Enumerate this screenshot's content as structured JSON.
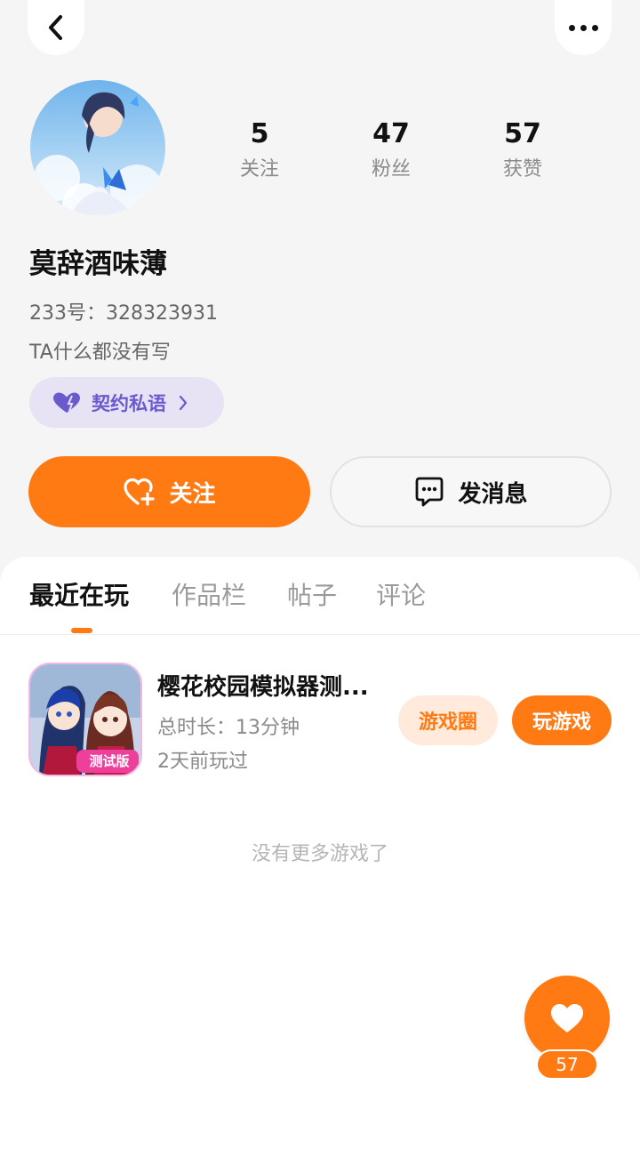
{
  "header": {
    "back_icon": "chevron-left-icon",
    "more_icon": "more-dots-icon"
  },
  "profile": {
    "nickname": "莫辞酒味薄",
    "uid_label": "233号：",
    "uid_value": "328323931",
    "bio": "TA什么都没有写",
    "stats": [
      {
        "value": "5",
        "label": "关注"
      },
      {
        "value": "47",
        "label": "粉丝"
      },
      {
        "value": "57",
        "label": "获赞"
      }
    ],
    "contract_label": "契约私语"
  },
  "actions": {
    "follow_label": "关注",
    "message_label": "发消息"
  },
  "tabs": [
    {
      "label": "最近在玩",
      "active": true
    },
    {
      "label": "作品栏",
      "active": false
    },
    {
      "label": "帖子",
      "active": false
    },
    {
      "label": "评论",
      "active": false
    }
  ],
  "games": [
    {
      "title": "樱花校园模拟器测...",
      "duration": "总时长：13分钟",
      "last_played": "2天前玩过",
      "icon_badge": "测试版",
      "circle_label": "游戏圈",
      "play_label": "玩游戏"
    }
  ],
  "list_end_text": "没有更多游戏了",
  "like_count": "57",
  "colors": {
    "accent": "#ff7a13",
    "accent_soft": "#ffeadb",
    "contract_bg": "#e7e3f5",
    "contract_text": "#6a5acd",
    "page_bg": "#f5f5f5"
  }
}
